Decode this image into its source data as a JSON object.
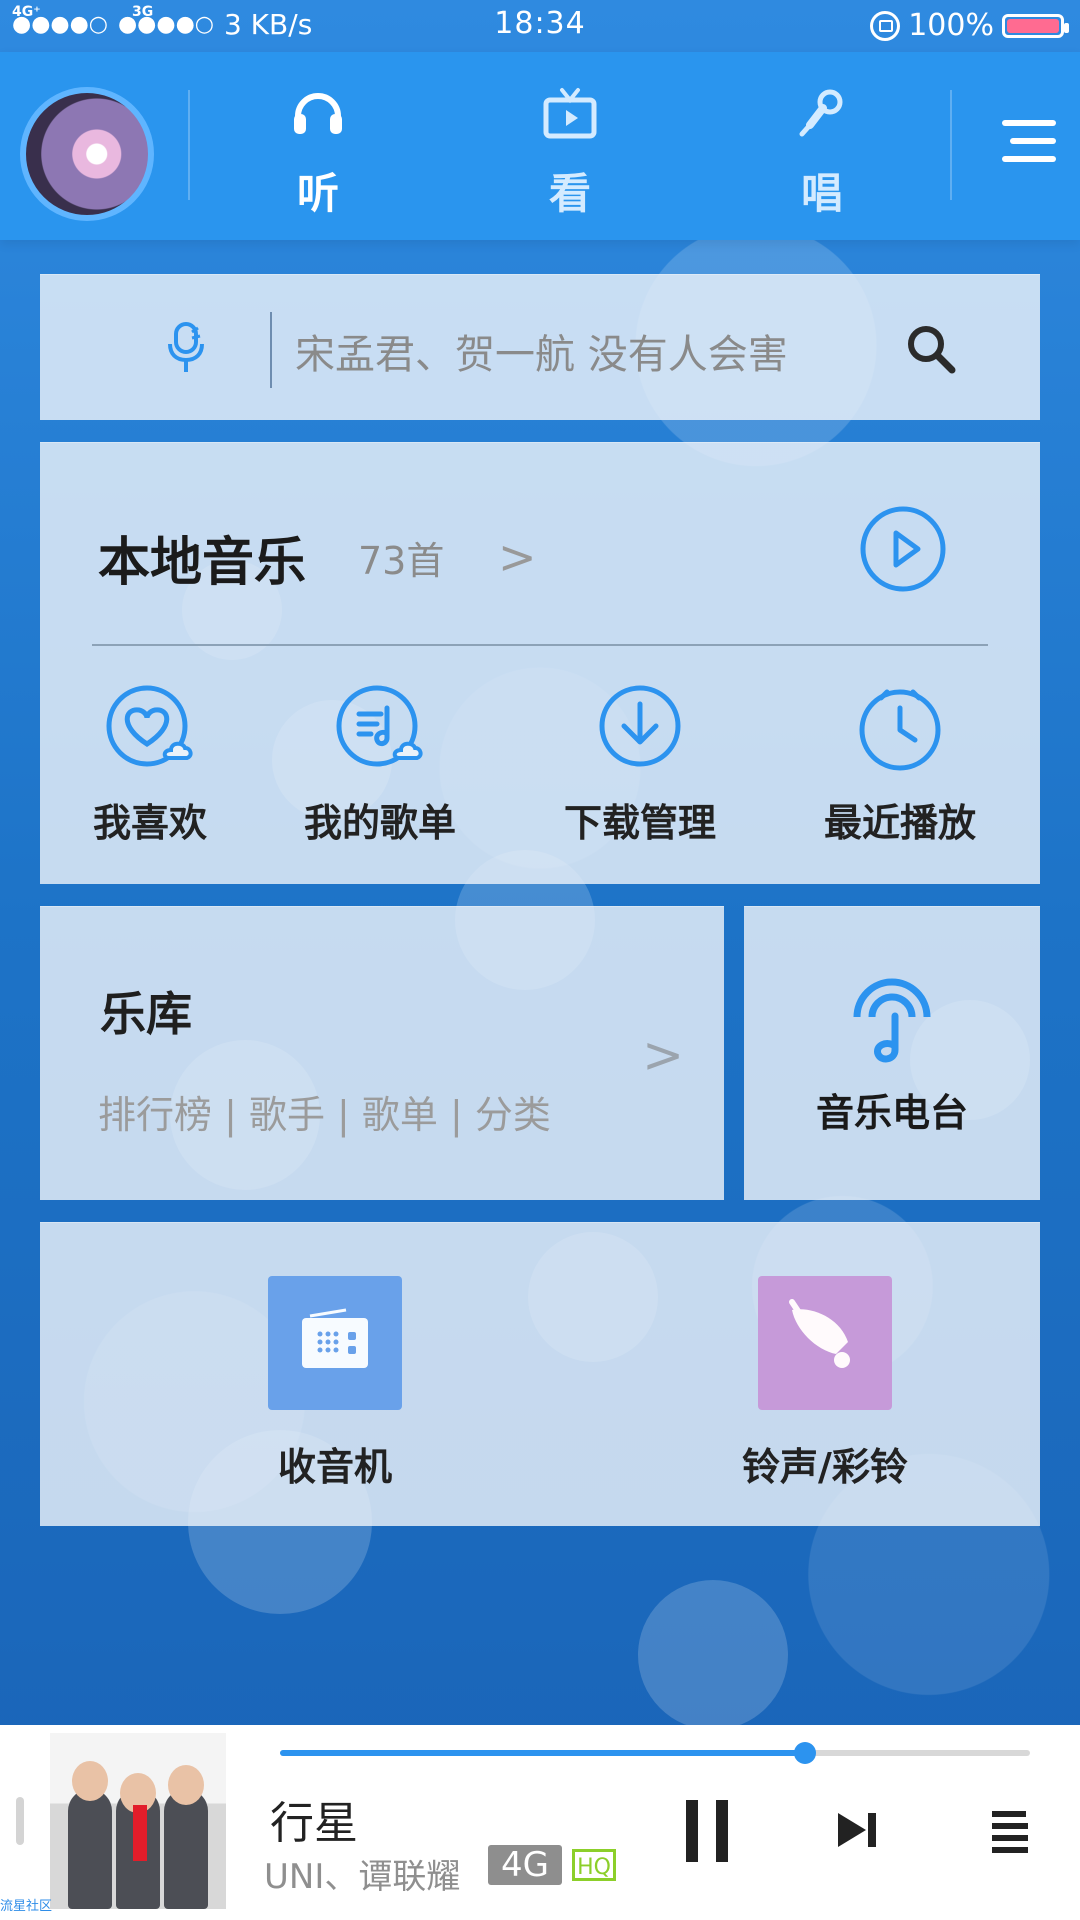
{
  "status": {
    "network1": "4G⁺",
    "network2": "3G",
    "signal1": "●●●●○",
    "signal2": "●●●●○",
    "speed": "3 KB/s",
    "time": "18:34",
    "battery": "100%"
  },
  "nav": {
    "avatar_icon": "avatar",
    "tabs": [
      {
        "label": "听",
        "icon": "headphones-icon"
      },
      {
        "label": "看",
        "icon": "tv-icon"
      },
      {
        "label": "唱",
        "icon": "microphone-icon"
      }
    ]
  },
  "search": {
    "placeholder": "宋孟君、贺一航 没有人会害"
  },
  "local_music": {
    "title": "本地音乐",
    "count": "73首",
    "arrow": ">",
    "items": [
      {
        "label": "我喜欢",
        "icon": "heart-cloud-icon"
      },
      {
        "label": "我的歌单",
        "icon": "music-list-cloud-icon"
      },
      {
        "label": "下载管理",
        "icon": "download-icon"
      },
      {
        "label": "最近播放",
        "icon": "clock-icon"
      }
    ]
  },
  "library": {
    "title": "乐库",
    "subtitle": "排行榜 | 歌手 | 歌单 | 分类",
    "arrow": ">"
  },
  "radio_station": {
    "label": "音乐电台"
  },
  "tools": {
    "radio": {
      "label": "收音机",
      "color": "#69a1ea"
    },
    "ringtone": {
      "label": "铃声/彩铃",
      "color": "#c69ad9"
    }
  },
  "player": {
    "song": "行星",
    "artist": "UNI、谭联耀",
    "network_tag": "4G",
    "quality_tag": "HQ",
    "progress": 0.7,
    "watermark": "流星社区"
  },
  "colors": {
    "accent": "#2c93ef",
    "top_bar": "#2a95ee",
    "panel": "#ebf2f9"
  }
}
